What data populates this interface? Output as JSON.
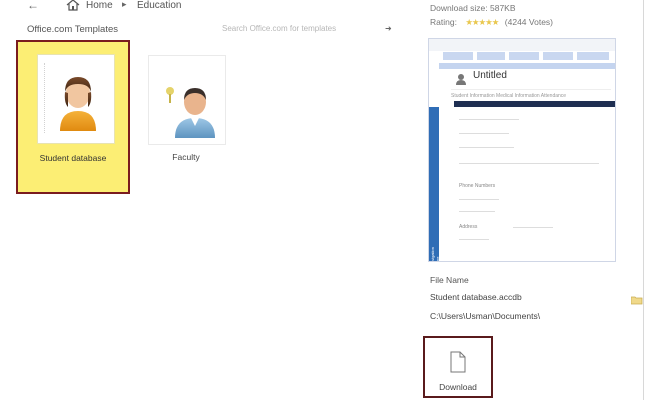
{
  "nav": {
    "back_glyph": "←",
    "home_label": "Home",
    "separator": "▸",
    "current_label": "Education"
  },
  "section_title": "Office.com Templates",
  "search": {
    "placeholder": "Search Office.com for templates",
    "go_glyph": "➜"
  },
  "templates": [
    {
      "label": "Student database",
      "selected": true,
      "icon": "student-avatar-icon"
    },
    {
      "label": "Faculty",
      "selected": false,
      "icon": "faculty-avatar-icon"
    }
  ],
  "details": {
    "download_size": "Download size: 587KB",
    "rating_label": "Rating:",
    "rating_stars": "★★★★★",
    "rating_votes": "(4244 Votes)",
    "preview_title": "Untitled",
    "preview_nav_pane": "Navigation Pane",
    "preview_tabs": "Student Information   Medical Information   Attendance",
    "preview_fields": [
      "Phone Numbers",
      "Address"
    ],
    "file_name_label": "File Name",
    "file_name_value": "Student database.accdb",
    "file_path": "C:\\Users\\Usman\\Documents\\"
  },
  "download": {
    "label": "Download",
    "icon": "document-icon"
  },
  "colors": {
    "selected_bg": "#fcee74",
    "selected_border": "#7a1c1f",
    "accent_blue": "#2f6db6"
  }
}
